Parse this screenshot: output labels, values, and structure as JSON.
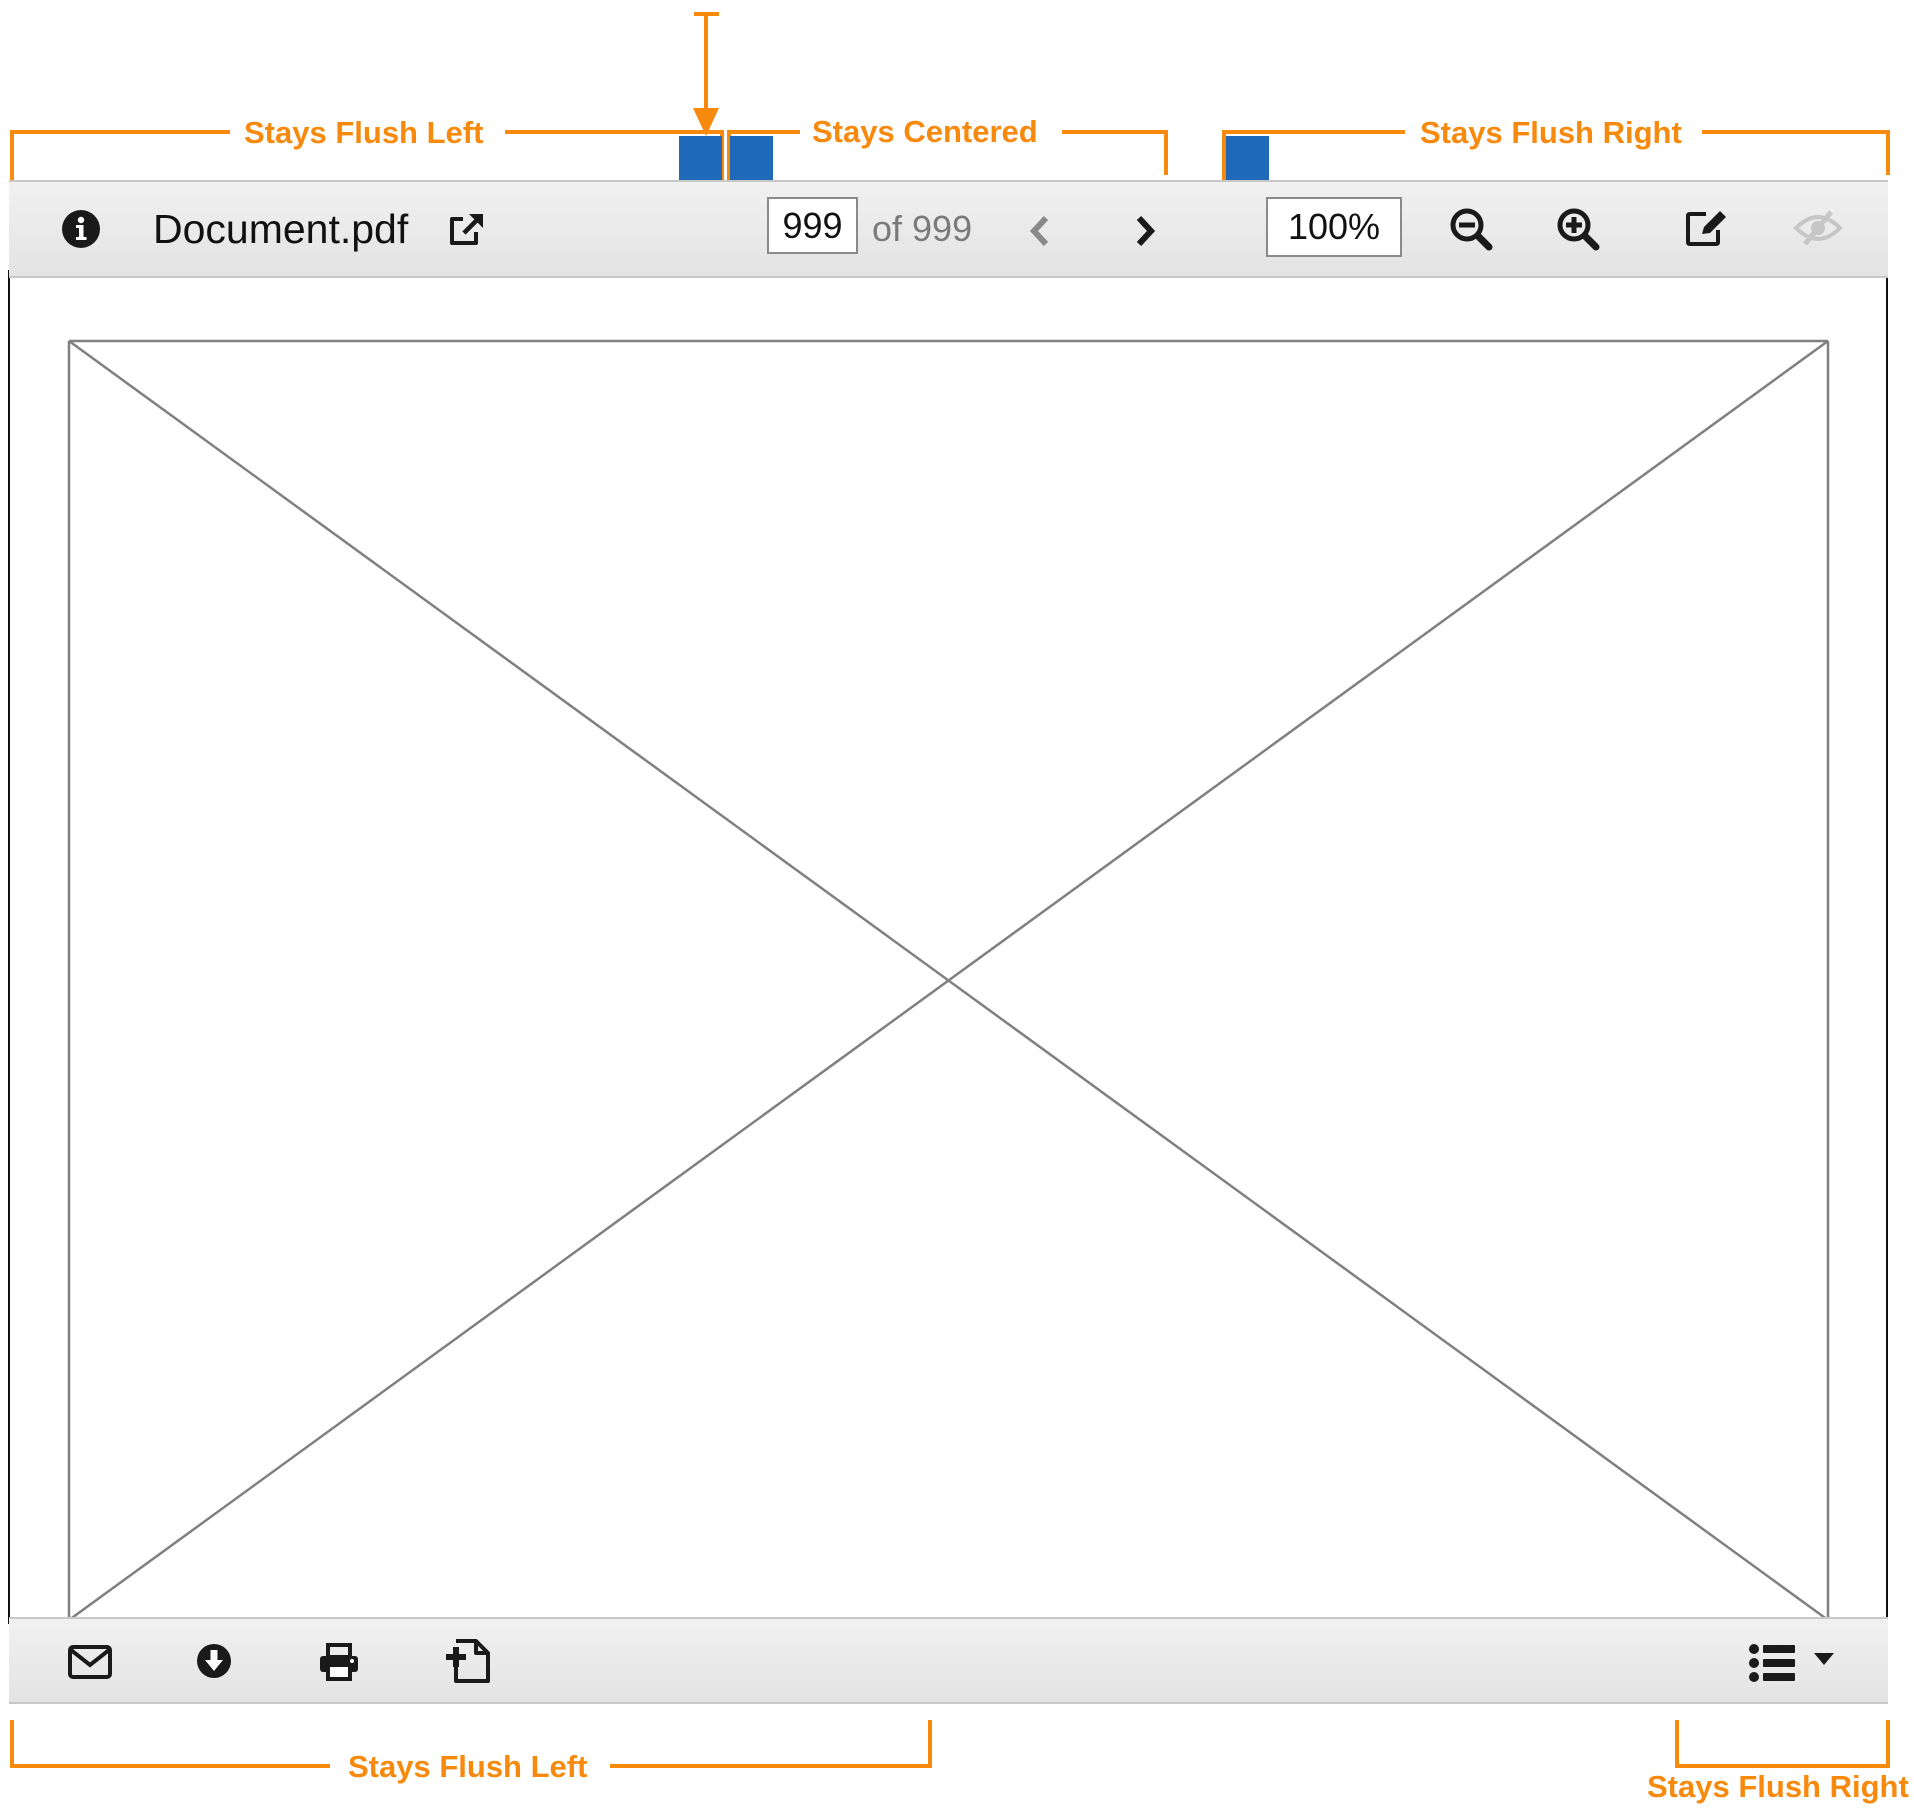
{
  "annotations": {
    "top_left": "Stays Flush Left",
    "top_center": "Stays Centered",
    "top_right": "Stays Flush Right",
    "bottom_left": "Stays Flush Left",
    "bottom_right": "Stays Flush Right"
  },
  "header": {
    "document_name": "Document.pdf",
    "page_input_value": "999",
    "page_total": "of 999",
    "zoom_value": "100%"
  },
  "icons": {
    "header": [
      "info-icon",
      "external-link-icon",
      "chevron-left-icon",
      "chevron-right-icon",
      "zoom-out-icon",
      "zoom-in-icon",
      "edit-icon",
      "eye-slash-icon"
    ],
    "footer": [
      "envelope-icon",
      "download-icon",
      "print-icon",
      "add-file-icon",
      "list-icon",
      "caret-down-icon"
    ]
  },
  "colors": {
    "annotation": "#f7890c",
    "marker": "#1f6ab8",
    "toolbar_bg": "#e8e8e8",
    "placeholder_line": "#808080"
  }
}
